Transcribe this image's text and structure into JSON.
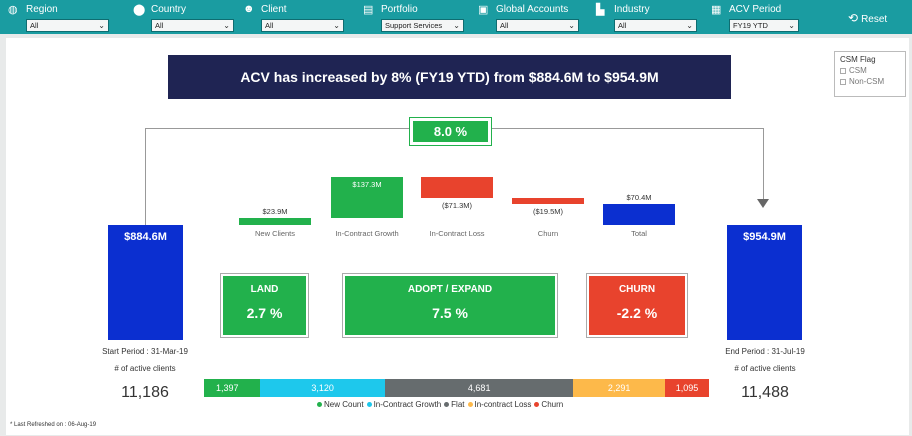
{
  "filters": [
    {
      "label": "Region",
      "value": "All",
      "icon": "globe-icon"
    },
    {
      "label": "Country",
      "value": "All",
      "icon": "location-pin-icon"
    },
    {
      "label": "Client",
      "value": "All",
      "icon": "people-icon"
    },
    {
      "label": "Portfolio",
      "value": "Support Services",
      "icon": "portfolio-icon"
    },
    {
      "label": "Global Accounts",
      "value": "All",
      "icon": "accounts-icon"
    },
    {
      "label": "Industry",
      "value": "All",
      "icon": "factory-icon"
    },
    {
      "label": "ACV Period",
      "value": "FY19 YTD",
      "icon": "calendar-icon"
    }
  ],
  "reset_label": "Reset",
  "headline": "ACV has increased by 8% (FY19 YTD) from $884.6M to $954.9M",
  "csm_flag": {
    "title": "CSM Flag",
    "options": [
      "CSM",
      "Non-CSM"
    ]
  },
  "growth_pct": "8.0 %",
  "start": {
    "value": "$884.6M",
    "period": "Start Period : 31-Mar-19",
    "clients_label": "# of active clients",
    "clients": "11,186"
  },
  "end": {
    "value": "$954.9M",
    "period": "End Period : 31-Jul-19",
    "clients_label": "# of active clients",
    "clients": "11,488"
  },
  "kpis": [
    {
      "title": "LAND",
      "value": "2.7 %",
      "color": "#22b14c"
    },
    {
      "title": "ADOPT / EXPAND",
      "value": "7.5 %",
      "color": "#22b14c"
    },
    {
      "title": "CHURN",
      "value": "-2.2 %",
      "color": "#e8432d"
    }
  ],
  "chart_data": [
    {
      "type": "bar",
      "subtype": "waterfall",
      "categories": [
        "New Clients",
        "In-Contract Growth",
        "In-Contract Loss",
        "Churn",
        "Total"
      ],
      "values": [
        23.9,
        137.3,
        -71.3,
        -19.5,
        70.4
      ],
      "labels": [
        "$23.9M",
        "$137.3M",
        "($71.3M)",
        "($19.5M)",
        "$70.4M"
      ],
      "colors": [
        "#22b14c",
        "#22b14c",
        "#e8432d",
        "#e8432d",
        "#0b2fd0"
      ]
    },
    {
      "type": "bar",
      "subtype": "stacked-horizontal",
      "series": [
        {
          "name": "New Count",
          "value": 1397,
          "label": "1,397",
          "color": "#22b14c"
        },
        {
          "name": "In-Contract Growth",
          "value": 3120,
          "label": "3,120",
          "color": "#1ec8ec"
        },
        {
          "name": "Flat",
          "value": 4681,
          "label": "4,681",
          "color": "#666c6e"
        },
        {
          "name": "In-contract Loss",
          "value": 2291,
          "label": "2,291",
          "color": "#fdb94a"
        },
        {
          "name": "Churn",
          "value": 1095,
          "label": "1,095",
          "color": "#e8432d"
        }
      ]
    }
  ],
  "footnote": "* Last Refreshed on : 06-Aug-19"
}
